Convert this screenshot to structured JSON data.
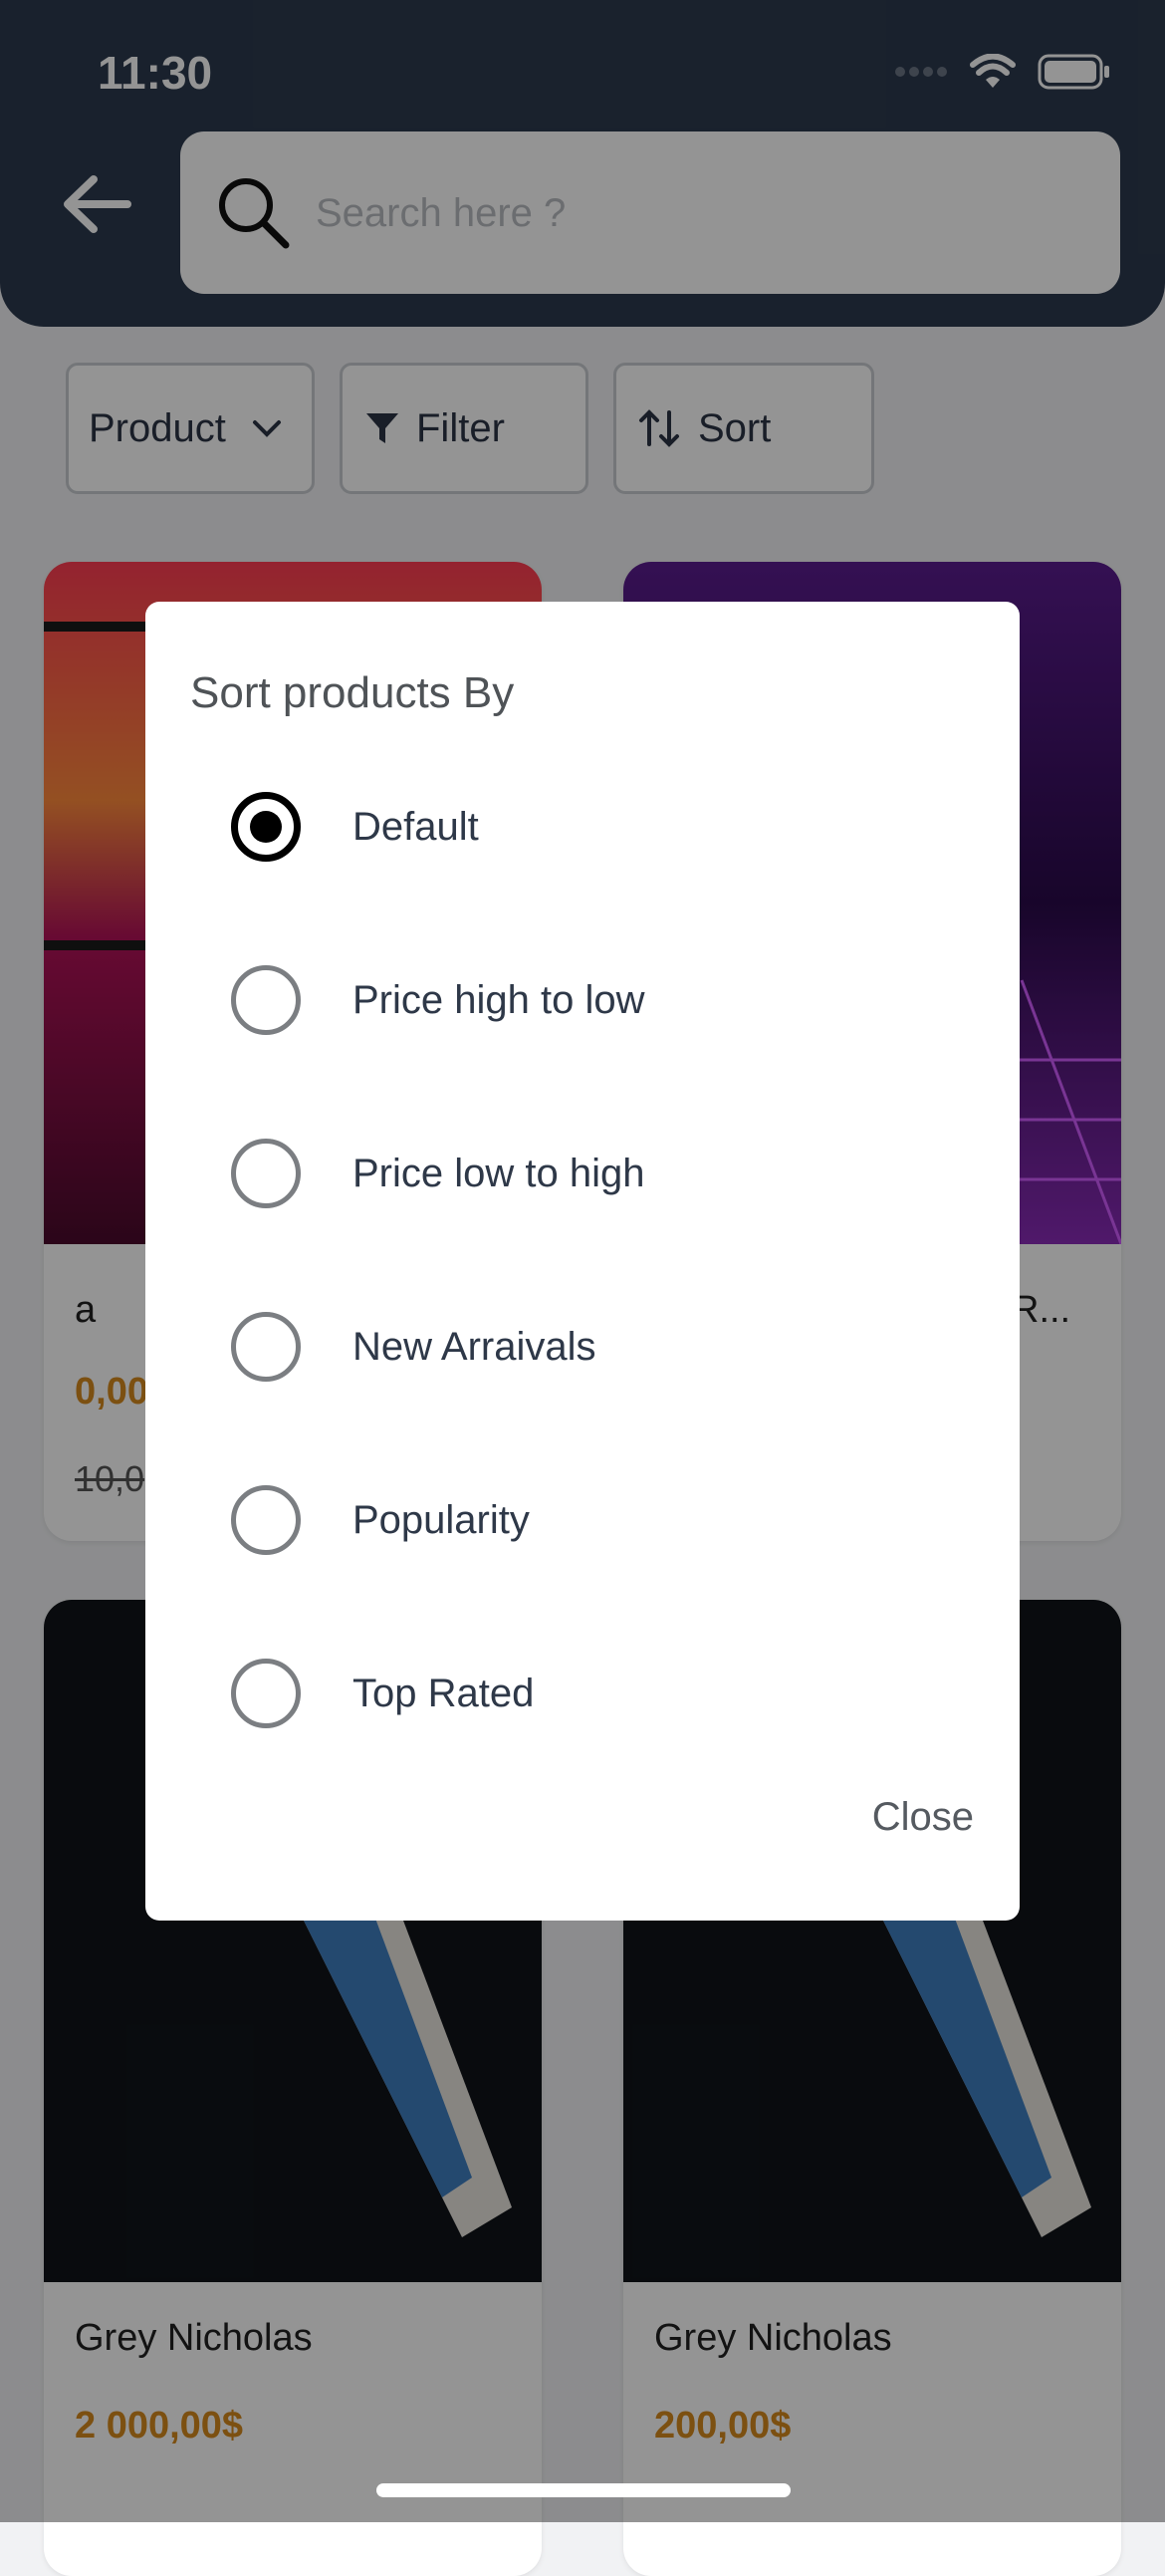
{
  "status_bar": {
    "time": "11:30"
  },
  "search": {
    "placeholder": "Search here ?"
  },
  "filters": [
    {
      "label": "Product"
    },
    {
      "label": "Filter"
    },
    {
      "label": "Sort"
    }
  ],
  "products": [
    {
      "name": "a",
      "price": "0,00",
      "old_price": "10,0"
    },
    {
      "name": "R...",
      "price": "",
      "old_price": ""
    },
    {
      "name": "Grey Nicholas",
      "price": "2 000,00$",
      "old_price": ""
    },
    {
      "name": "Grey Nicholas",
      "price": "200,00$",
      "old_price": ""
    }
  ],
  "dialog": {
    "title": "Sort products By",
    "options": [
      {
        "label": "Default",
        "selected": true
      },
      {
        "label": "Price high to low",
        "selected": false
      },
      {
        "label": "Price low to high",
        "selected": false
      },
      {
        "label": "New Arraivals",
        "selected": false
      },
      {
        "label": "Popularity",
        "selected": false
      },
      {
        "label": "Top Rated",
        "selected": false
      }
    ],
    "close_label": "Close"
  },
  "colors": {
    "header_bg": "#2c3a4e",
    "price": "#d68a1e",
    "overlay": "rgba(0,0,0,0.42)"
  }
}
